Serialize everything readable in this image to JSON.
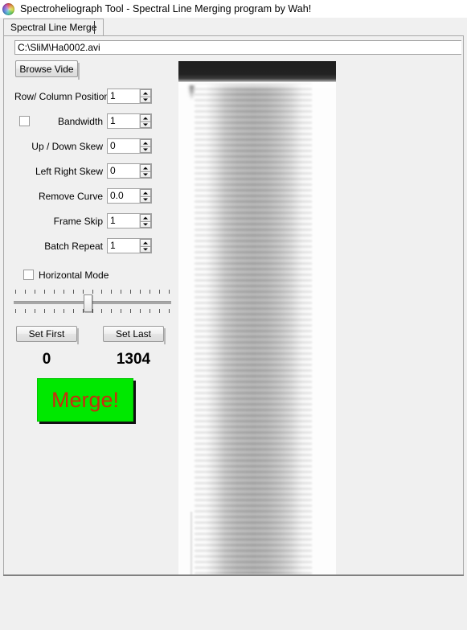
{
  "window": {
    "title": "Spectroheliograph Tool - Spectral Line Merging program by Wah!",
    "icon": "spectrum-circle-icon"
  },
  "tabs": [
    {
      "label": "Spectral Line Merge",
      "selected": true
    }
  ],
  "file_path": {
    "value": "C:\\SliM\\Ha0002.avi",
    "placeholder": ""
  },
  "buttons": {
    "browse": "Browse Vide",
    "set_first": "Set First",
    "set_last": "Set Last",
    "merge": "Merge!"
  },
  "params": [
    {
      "label": "Row/ Column Position",
      "value": "1"
    },
    {
      "label": "Bandwidth",
      "value": "1"
    },
    {
      "label": "Up / Down Skew",
      "value": "0"
    },
    {
      "label": "Left Right Skew",
      "value": "0"
    },
    {
      "label": "Remove Curve",
      "value": "0.0"
    },
    {
      "label": "Frame Skip",
      "value": "1"
    },
    {
      "label": "Batch Repeat",
      "value": "1"
    }
  ],
  "checkboxes": {
    "bandwidth_enable": {
      "label": "",
      "checked": false
    },
    "horizontal_mode": {
      "label": "Horizontal Mode",
      "checked": false
    }
  },
  "range": {
    "first_frame": "0",
    "last_frame": "1304",
    "slider_position_pct": 47,
    "tick_count": 17
  },
  "colors": {
    "merge_bg": "#00e800",
    "merge_text": "#cc2a10",
    "window_bg": "#f0f0f0",
    "field_bg": "#ffffff",
    "border": "#a9a9a9"
  },
  "preview": {
    "name": "spectral-frame-preview"
  }
}
